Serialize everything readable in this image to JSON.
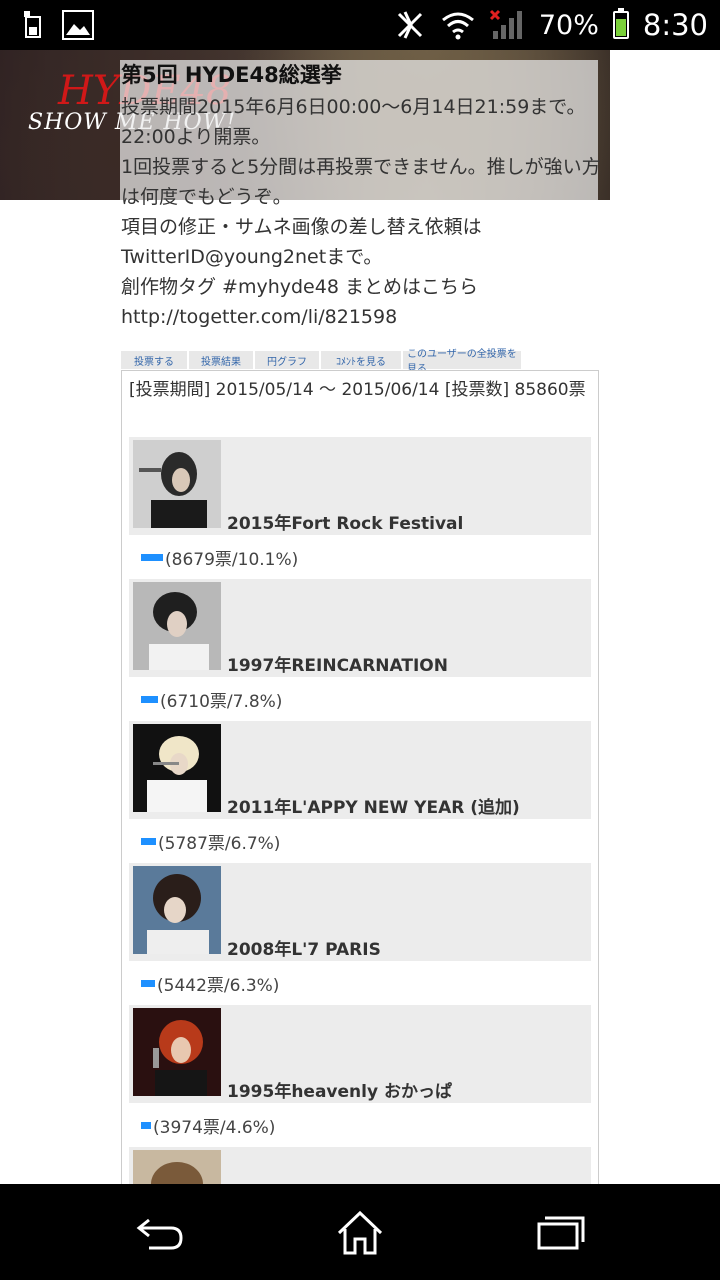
{
  "status": {
    "battery": "70%",
    "time": "8:30"
  },
  "banner": {
    "logo_title": "HYDE48",
    "logo_sub": "SHOW ME HOW!"
  },
  "poll": {
    "title": "第5回 HYDE48総選挙",
    "description": "投票期間2015年6月6日00:00〜6月14日21:59まで。22:00より開票。\n1回投票すると5分間は再投票できません。推しが強い方は何度でもどうぞ。\n項目の修正・サムネ画像の差し替え依頼はTwitterID@young2netまで。\n創作物タグ #myhyde48 まとめはこちら\nhttp://togetter.com/li/821598",
    "meta": "[投票期間] 2015/05/14 〜 2015/06/14  [投票数] 85860票",
    "tabs": [
      "投票する",
      "投票結果",
      "円グラフ",
      "ｺﾒﾝﾄを見る",
      "このユーザーの全投票を見る"
    ],
    "entries": [
      {
        "title": "2015年Fort Rock Festival",
        "result": "(8679票/10.1%)",
        "percent": 10.1
      },
      {
        "title": "1997年REINCARNATION",
        "result": "(6710票/7.8%)",
        "percent": 7.8
      },
      {
        "title": "2011年L'APPY NEW YEAR (追加)",
        "result": "(5787票/6.7%)",
        "percent": 6.7
      },
      {
        "title": "2008年L'7 PARIS",
        "result": "(5442票/6.3%)",
        "percent": 6.3
      },
      {
        "title": "1995年heavenly おかっぱ",
        "result": "(3974票/4.6%)",
        "percent": 4.6
      }
    ]
  }
}
